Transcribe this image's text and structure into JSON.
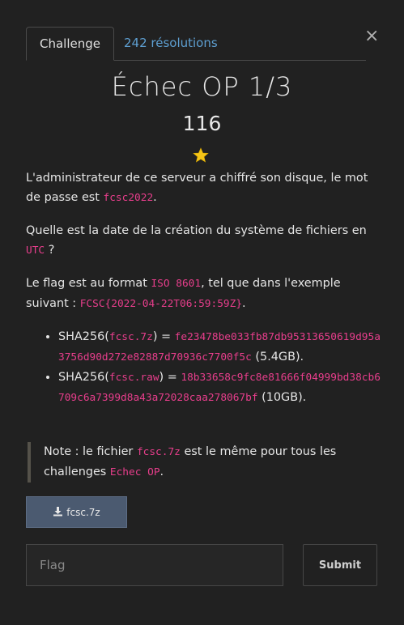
{
  "tabs": [
    {
      "label": "Challenge"
    },
    {
      "label": "242 résolutions"
    }
  ],
  "close_icon": "×",
  "challenge": {
    "title": "Échec OP 1/3",
    "value": "116",
    "star_icon": "star-icon",
    "star_color": "#f5c518"
  },
  "description": {
    "p1_text": "L'administrateur de ce serveur a chiffré son disque, le mot de passe est ",
    "p1_code": "fcsc2022",
    "p1_end": ".",
    "p2_text": "Quelle est la date de la création du système de fichiers en ",
    "p2_code": "UTC",
    "p2_end": " ?",
    "p3_text": "Le flag est au format ",
    "p3_code1": "ISO 8601",
    "p3_mid": ", tel que dans l'exemple suivant : ",
    "p3_code2": "FCSC{2022-04-22T06:59:59Z}",
    "p3_end": ".",
    "hashes": [
      {
        "prefix": "SHA256(",
        "file": "fcsc.7z",
        "mid": ") = ",
        "hash": "fe23478be033fb87db95313650619d95a3756d90d272e82887d70936c7700f5c",
        "size": " (5.4GB)."
      },
      {
        "prefix": "SHA256(",
        "file": "fcsc.raw",
        "mid": ") = ",
        "hash": "18b33658c9fc8e81666f04999bd38cb6709c6a7399d8a43a72028caa278067bf",
        "size": " (10GB)."
      }
    ]
  },
  "note": {
    "text1": "Note : le fichier ",
    "code1": "fcsc.7z",
    "text2": " est le même pour tous les challenges ",
    "code2": "Echec OP",
    "text3": "."
  },
  "download": {
    "label": "fcsc.7z",
    "icon": "download-icon"
  },
  "form": {
    "placeholder": "Flag",
    "value": "",
    "submit_label": "Submit"
  }
}
